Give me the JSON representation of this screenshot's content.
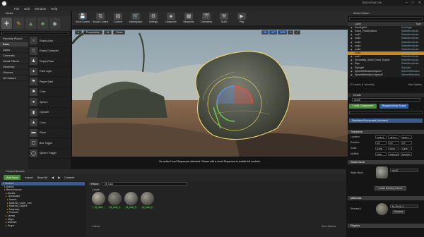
{
  "window": {
    "title": "Barrenharrow"
  },
  "menu": [
    "File",
    "Edit",
    "Window",
    "Help"
  ],
  "modes_tab": "Modes",
  "place": {
    "categories": [
      "Recently Placed",
      "Basic",
      "Lights",
      "Cinematic",
      "Visual Effects",
      "Geometry",
      "Volumes",
      "All Classes"
    ],
    "selected_category": "Basic",
    "items": [
      {
        "label": "Empty Actor",
        "icon": "circle"
      },
      {
        "label": "Empty Character",
        "icon": "character"
      },
      {
        "label": "Empty Pawn",
        "icon": "pawn"
      },
      {
        "label": "Point Light",
        "icon": "light"
      },
      {
        "label": "Player Start",
        "icon": "flag"
      },
      {
        "label": "Cube",
        "icon": "cube"
      },
      {
        "label": "Sphere",
        "icon": "sphere"
      },
      {
        "label": "Cylinder",
        "icon": "cylinder"
      },
      {
        "label": "Cone",
        "icon": "cone"
      },
      {
        "label": "Plane",
        "icon": "plane"
      },
      {
        "label": "Box Trigger",
        "icon": "box"
      },
      {
        "label": "Sphere Trigger",
        "icon": "sphere-trigger"
      }
    ]
  },
  "toolbar": [
    {
      "label": "Save Current",
      "icon": "save"
    },
    {
      "label": "Source Control",
      "icon": "source"
    },
    {
      "label": "Content",
      "icon": "content"
    },
    {
      "label": "Marketplace",
      "icon": "market"
    },
    {
      "label": "Settings",
      "icon": "settings"
    },
    {
      "label": "Datasmith",
      "icon": "datasmith"
    },
    {
      "label": "Blueprints",
      "icon": "blueprint"
    },
    {
      "label": "Cinematics",
      "icon": "film"
    },
    {
      "label": "Build",
      "icon": "build"
    },
    {
      "label": "Play",
      "icon": "play"
    }
  ],
  "viewport": {
    "buttons": [
      "Perspective",
      "Lit",
      "Show"
    ],
    "right_buttons": [
      "10",
      "10°",
      "0.25",
      "4"
    ],
    "message": "No active Level Sequencer detected. Please edit a Level Sequence to enable full controls."
  },
  "world_outliner": {
    "tab": "World Outliner",
    "col_label": "Label",
    "col_type": "Type",
    "rows": [
      {
        "label": "PointLight2",
        "type": "PointLight",
        "selected": false
      },
      {
        "label": "Robot_PlaceholderA",
        "type": "StaticMeshActor",
        "selected": false
      },
      {
        "label": "rock1",
        "type": "StaticMeshActor",
        "selected": false
      },
      {
        "label": "rock2",
        "type": "StaticMeshActor",
        "selected": false
      },
      {
        "label": "rock3",
        "type": "StaticMeshActor",
        "selected": false
      },
      {
        "label": "rock4",
        "type": "StaticMeshActor",
        "selected": false
      },
      {
        "label": "rock5",
        "type": "StaticMeshActor",
        "selected": false
      },
      {
        "label": "rock6",
        "type": "StaticMeshActor",
        "selected": true
      },
      {
        "label": "rock7",
        "type": "StaticMeshActor",
        "selected": false
      },
      {
        "label": "Secondary_Asset_Down_Engine",
        "type": "StaticMeshActor",
        "selected": false
      },
      {
        "label": "Sign",
        "type": "StaticMeshActor",
        "selected": false
      },
      {
        "label": "SkyLight",
        "type": "SkyLight",
        "selected": false
      },
      {
        "label": "SphereReflectionCapture",
        "type": "SphereReflection",
        "selected": false
      },
      {
        "label": "SphereReflectionCapture2",
        "type": "SphereReflection",
        "selected": false
      }
    ],
    "footer_count": "174 actors (1 selected)",
    "footer_view": "View Options"
  },
  "details": {
    "tab": "Details",
    "name": "rock6",
    "add_component": "+ Add Component",
    "blueprint_btn": "Blueprint/Add Script",
    "component": "StaticMeshComponent (Inherited)",
    "transform_title": "Transform",
    "transform": [
      {
        "label": "Location",
        "x": "-5783.6",
        "y": "-4874.9",
        "z": "3018.3"
      },
      {
        "label": "Rotation",
        "x": "0.0°",
        "y": "0.0°",
        "z": "0.0°"
      },
      {
        "label": "Scale",
        "x": "4.375",
        "y": "4.375",
        "z": "4.375"
      },
      {
        "label": "Mobility",
        "x": "Static",
        "y": "Stationary",
        "z": "Movable"
      }
    ],
    "static_mesh_title": "Static Mesh",
    "static_mesh_label": "Static Mesh",
    "static_mesh_value": "rock7",
    "mesh_btn": "Create Blocking Volume",
    "materials_title": "Materials",
    "element_label": "Element 0",
    "material_value": "M_Rock_2",
    "material_tex": "Textures",
    "physics_title": "Physics"
  },
  "content_browser": {
    "tab": "Content Browser",
    "add_new": "Add New",
    "import": "Import",
    "save_all": "Save All",
    "path": "Content",
    "filters": "Filters",
    "search": "M_rock",
    "level_label": "Level",
    "tree": [
      {
        "label": "Content",
        "selected": true
      },
      {
        "label": "Assets"
      },
      {
        "label": "Barrenharrow"
      },
      {
        "label": "Assets"
      },
      {
        "label": "Landscape"
      },
      {
        "label": "Assets"
      },
      {
        "label": "Material_Layer_Info"
      },
      {
        "label": "Material_Layers"
      },
      {
        "label": "Materials"
      },
      {
        "label": "Textures"
      },
      {
        "label": "Levels"
      },
      {
        "label": "Maps"
      },
      {
        "label": "Meshes"
      },
      {
        "label": "Props"
      }
    ],
    "assets": [
      {
        "name": "M_rock",
        "color": "#b9b2a2"
      },
      {
        "name": "M_rock_2",
        "color": "#8a8a80"
      },
      {
        "name": "M_rock_3",
        "color": "#a5a59a"
      },
      {
        "name": "M_rock_4",
        "color": "#9c9a8f"
      }
    ],
    "items_count": "4 items",
    "view_options": "View Options"
  },
  "colors": {
    "accent_green": "#4a8a3a",
    "selection_orange": "#c88a18",
    "blue": "#2d5fa8"
  }
}
